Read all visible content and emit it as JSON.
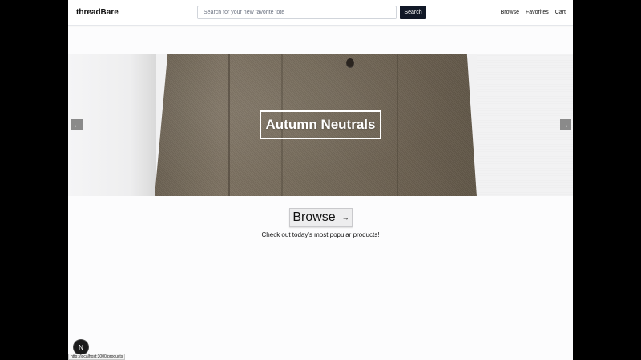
{
  "header": {
    "logo": "threadBare",
    "search_placeholder": "Search for your new favorite tote",
    "search_value": "",
    "search_button": "Search",
    "nav": [
      "Browse",
      "Favorites",
      "Cart"
    ]
  },
  "hero": {
    "title": "Autumn Neutrals",
    "prev_icon": "arrow-left-icon",
    "next_icon": "arrow-right-icon"
  },
  "cta": {
    "label": "Browse",
    "arrow_icon": "arrow-right-icon",
    "caption": "Check out today's most popular products!"
  },
  "dev_badge": "N",
  "status_url": "http://localhost:3000/products",
  "colors": {
    "search_button_bg": "#111827",
    "page_bg": "#fcfcfd",
    "outer_bg": "#000000"
  }
}
